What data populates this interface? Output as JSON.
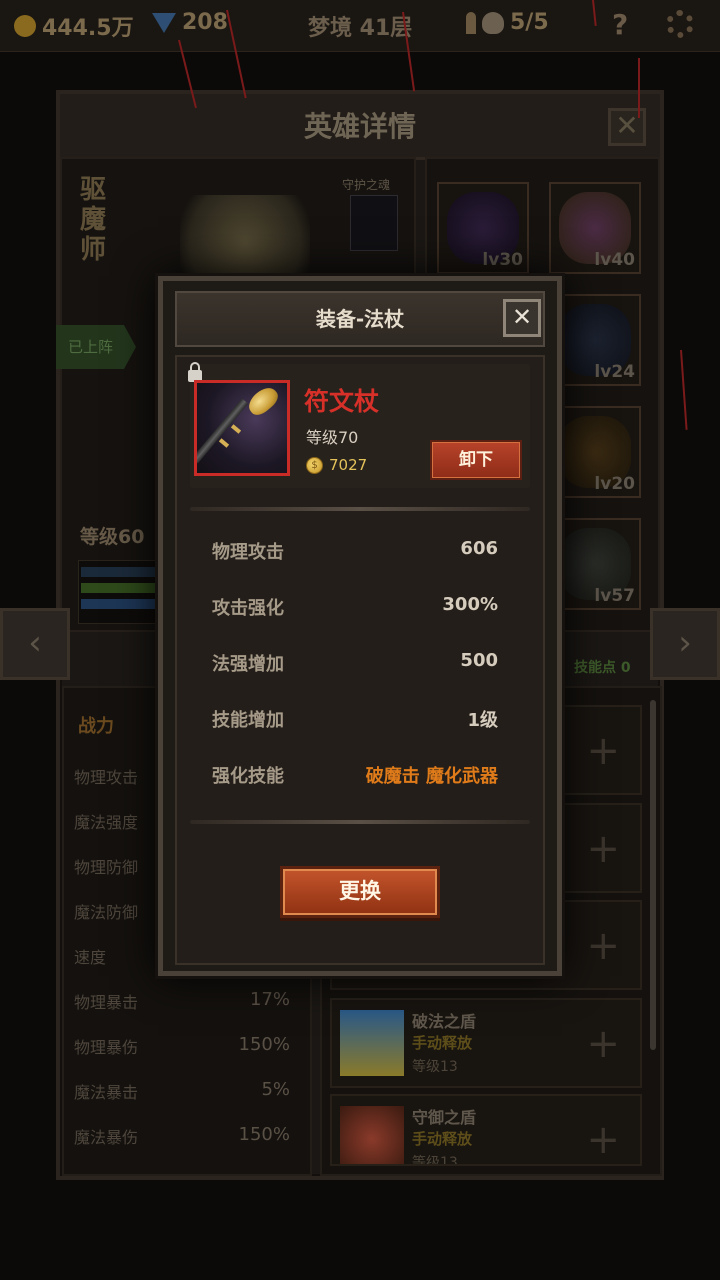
{
  "topbar": {
    "gold": "444.5万",
    "gems": "208",
    "dungeon": "梦境 41层",
    "keys": "5/5"
  },
  "hero_panel": {
    "title": "英雄详情",
    "class_name": "驱魔师",
    "guardian_label": "守护之魂",
    "deployed": "已上阵",
    "level": "等级60",
    "equipment_levels": [
      "lv30",
      "lv40",
      "lv24",
      "lv20",
      "lv57"
    ],
    "stats_header": "战力",
    "stats": [
      {
        "label": "物理攻击",
        "value": ""
      },
      {
        "label": "魔法强度",
        "value": ""
      },
      {
        "label": "物理防御",
        "value": ""
      },
      {
        "label": "魔法防御",
        "value": ""
      },
      {
        "label": "速度",
        "value": ""
      },
      {
        "label": "物理暴击",
        "value": "17%"
      },
      {
        "label": "物理暴伤",
        "value": "150%"
      },
      {
        "label": "魔法暴击",
        "value": "5%"
      },
      {
        "label": "魔法暴伤",
        "value": "150%"
      }
    ],
    "skill_points": "技能点 0",
    "skills": [
      {
        "name": "破法之盾",
        "mode": "手动释放",
        "level": "等级13"
      },
      {
        "name": "守御之盾",
        "mode": "手动释放",
        "level": "等级13"
      }
    ]
  },
  "modal": {
    "title": "装备-法杖",
    "close_symbol": "✕",
    "item_name": "符文杖",
    "item_level": "等级70",
    "item_price": "7027",
    "unequip_label": "卸下",
    "attributes": [
      {
        "label": "物理攻击",
        "value": "606"
      },
      {
        "label": "攻击强化",
        "value": "300%"
      },
      {
        "label": "法强增加",
        "value": "500"
      },
      {
        "label": "技能增加",
        "value": "1级"
      },
      {
        "label": "强化技能",
        "value": "破魔击 魔化武器"
      }
    ],
    "replace_label": "更换"
  },
  "colors": {
    "item_name": "#d63029",
    "skill_text": "#e07b1a",
    "gold_text": "#e3c25a",
    "button": "#b8432a"
  },
  "icons": [
    "coin-icon",
    "gem-icon",
    "key-icon",
    "skull-icon",
    "help-icon",
    "gear-icon",
    "lock-icon",
    "gold-coin-icon",
    "staff-icon",
    "close-icon",
    "chevron-left-icon",
    "chevron-right-icon",
    "plus-icon"
  ]
}
